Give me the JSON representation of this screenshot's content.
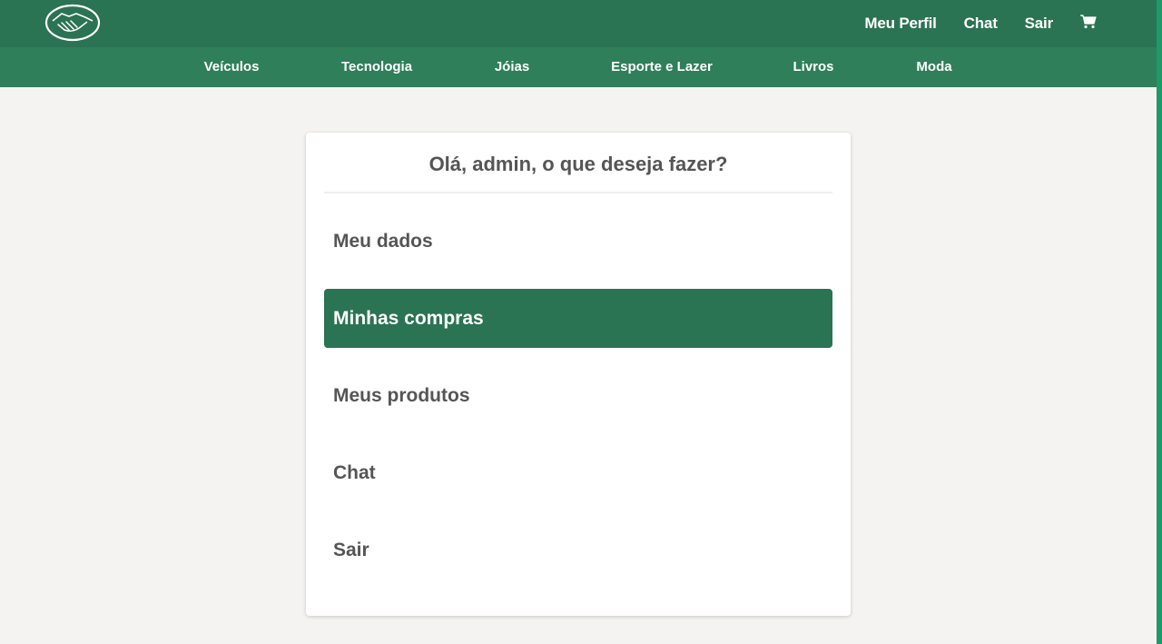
{
  "header": {
    "logo_icon": "handshake-logo-icon",
    "links": [
      "Meu Perfil",
      "Chat",
      "Sair"
    ],
    "cart_icon": "shopping-cart-icon",
    "color": "#2a7353"
  },
  "categories": [
    "Veículos",
    "Tecnologia",
    "Jóias",
    "Esporte e Lazer",
    "Livros",
    "Moda"
  ],
  "panel": {
    "title": "Olá, admin, o que deseja fazer?",
    "items": [
      {
        "label": "Meu dados",
        "active": false
      },
      {
        "label": "Minhas compras",
        "active": true
      },
      {
        "label": "Meus produtos",
        "active": false
      },
      {
        "label": "Chat",
        "active": false
      },
      {
        "label": "Sair",
        "active": false
      }
    ],
    "active_color": "#2a7353"
  }
}
